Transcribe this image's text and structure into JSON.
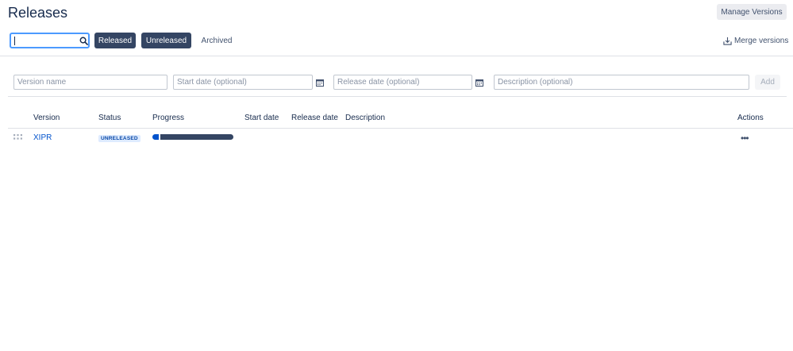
{
  "page": {
    "title": "Releases"
  },
  "header": {
    "manage_versions_label": "Manage Versions"
  },
  "filters": {
    "search": {
      "value": "",
      "placeholder": ""
    },
    "released_label": "Released",
    "unreleased_label": "Unreleased",
    "archived_label": "Archived",
    "merge_label": "Merge versions"
  },
  "form": {
    "version_name_placeholder": "Version name",
    "start_date_placeholder": "Start date (optional)",
    "release_date_placeholder": "Release date (optional)",
    "description_placeholder": "Description (optional)",
    "add_label": "Add"
  },
  "table": {
    "headers": [
      "Version",
      "Status",
      "Progress",
      "Start date",
      "Release date",
      "Description",
      "Actions"
    ],
    "rows": [
      {
        "version": "XIPR",
        "status": "UNRELEASED",
        "progress_done_fraction": 0.08,
        "start_date": "",
        "release_date": "",
        "description": "",
        "actions_label": "•••"
      }
    ]
  },
  "colors": {
    "link": "#0052cc",
    "active_button": "#344563",
    "progress_done": "#0052cc",
    "progress_todo": "#344563",
    "lozenge_bg": "#deebff",
    "lozenge_text": "#0747a6"
  },
  "icons": {
    "search": "search-icon",
    "calendar": "calendar-icon",
    "merge": "merge-icon",
    "drag": "drag-handle-icon",
    "actions": "more-icon"
  }
}
